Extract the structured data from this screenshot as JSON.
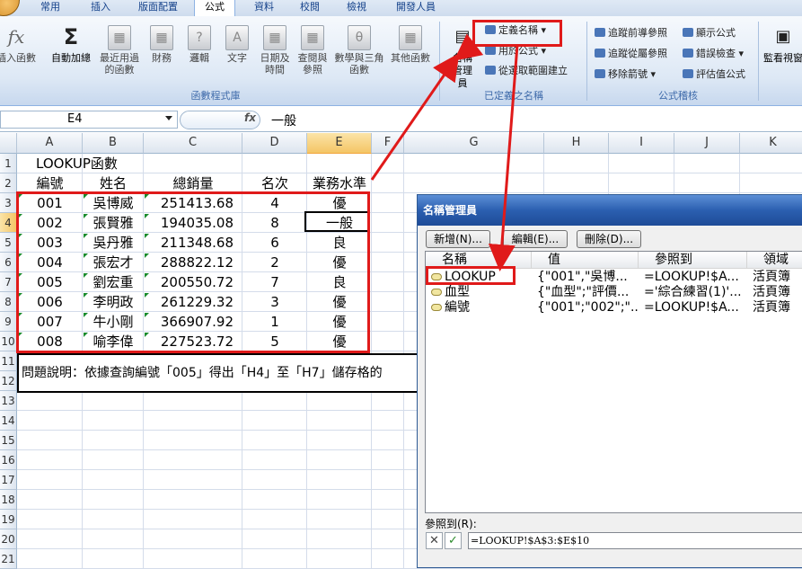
{
  "tabs": [
    "常用",
    "插入",
    "版面配置",
    "公式",
    "資料",
    "校閱",
    "檢視",
    "開發人員"
  ],
  "ribbon": {
    "insert_function": "插入函數",
    "buttons": [
      {
        "label": "自動加總",
        "icon": "Σ"
      },
      {
        "label": "最近用過的函數",
        "icon": "▦"
      },
      {
        "label": "財務",
        "icon": "▦"
      },
      {
        "label": "邏輯",
        "icon": "?"
      },
      {
        "label": "文字",
        "icon": "A"
      },
      {
        "label": "日期及時間",
        "icon": "▦"
      },
      {
        "label": "查閱與參照",
        "icon": "▦"
      },
      {
        "label": "數學與三角函數",
        "icon": "θ"
      },
      {
        "label": "其他函數",
        "icon": "▦"
      }
    ],
    "group_library": "函數程式庫",
    "name_manager": "名稱管理員",
    "define_name": "定義名稱",
    "use_in_formula": "用於公式",
    "create_from_selection": "從選取範圍建立",
    "group_defined_names": "已定義之名稱",
    "trace_precedents": "追蹤前導參照",
    "trace_dependents": "追蹤從屬參照",
    "remove_arrows": "移除箭號",
    "show_formulas": "顯示公式",
    "error_checking": "錯誤檢查",
    "evaluate_formula": "評估值公式",
    "group_auditing": "公式稽核",
    "watch_window": "監看視窗"
  },
  "formula_bar": {
    "name_box": "E4",
    "fx": "fx",
    "value": "一般"
  },
  "columns": [
    "A",
    "B",
    "C",
    "D",
    "E",
    "F",
    "G",
    "H",
    "I",
    "J",
    "K"
  ],
  "rows": [
    "1",
    "2",
    "3",
    "4",
    "5",
    "6",
    "7",
    "8",
    "9",
    "10",
    "11",
    "12",
    "13",
    "14",
    "15",
    "16",
    "17",
    "18",
    "19",
    "20",
    "21"
  ],
  "sheet": {
    "title": "LOOKUP函數",
    "headers": [
      "編號",
      "姓名",
      "總銷量",
      "名次",
      "業務水準"
    ],
    "data": [
      [
        "001",
        "吳博威",
        "251413.68",
        "4",
        "優"
      ],
      [
        "002",
        "張賢雅",
        "194035.08",
        "8",
        "一般"
      ],
      [
        "003",
        "吳丹雅",
        "211348.68",
        "6",
        "良"
      ],
      [
        "004",
        "張宏才",
        "288822.12",
        "2",
        "優"
      ],
      [
        "005",
        "劉宏重",
        "200550.72",
        "7",
        "良"
      ],
      [
        "006",
        "李明政",
        "261229.32",
        "3",
        "優"
      ],
      [
        "007",
        "牛小剛",
        "366907.92",
        "1",
        "優"
      ],
      [
        "008",
        "喻李偉",
        "227523.72",
        "5",
        "優"
      ]
    ],
    "note": "問題說明：依據查詢編號「005」得出「H4」至「H7」儲存格的"
  },
  "name_manager": {
    "title": "名稱管理員",
    "new_button": "新增(N)...",
    "edit_button": "編輯(E)...",
    "delete_button": "刪除(D)...",
    "columns": [
      "名稱",
      "值",
      "參照到",
      "領域"
    ],
    "entries": [
      {
        "name": "LOOKUP",
        "value": "{\"001\",\"吳博...",
        "refers_to": "=LOOKUP!$A...",
        "scope": "活頁簿"
      },
      {
        "name": "血型",
        "value": "{\"血型\";\"評價...",
        "refers_to": "='綜合練習(1)'...",
        "scope": "活頁簿"
      },
      {
        "name": "編號",
        "value": "{\"001\";\"002\";\"...",
        "refers_to": "=LOOKUP!$A...",
        "scope": "活頁簿"
      }
    ],
    "refers_to_label": "參照到(R):",
    "refers_to_value": "=LOOKUP!$A$3:$E$10",
    "cancel_icon": "✕",
    "confirm_icon": "✓"
  },
  "colors": {
    "highlight": "#e01a1a",
    "accent": "#2b5fb0"
  }
}
